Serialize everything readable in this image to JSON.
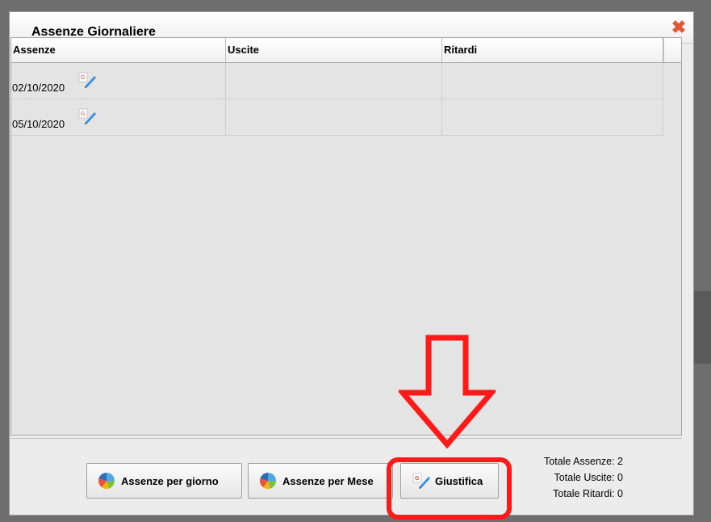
{
  "dialog": {
    "title": "Assenze Giornaliere",
    "close_icon": "close-x-icon",
    "close_color": "#e05a3a"
  },
  "table": {
    "columns": [
      "Assenze",
      "Uscite",
      "Ritardi"
    ],
    "rows": [
      {
        "assenze": "02/10/2020",
        "uscite": "",
        "ritardi": "",
        "icon": "justify-edit-icon"
      },
      {
        "assenze": "05/10/2020",
        "uscite": "",
        "ritardi": "",
        "icon": "justify-edit-icon"
      }
    ]
  },
  "buttons": {
    "per_giorno": {
      "label": "Assenze per giorno",
      "icon": "pie-chart-icon"
    },
    "per_mese": {
      "label": "Assenze per Mese",
      "icon": "pie-chart-icon"
    },
    "giustifica": {
      "label": "Giustifica",
      "icon": "justify-edit-icon"
    }
  },
  "totals": {
    "assenze": "Totale Assenze: 2",
    "uscite": "Totale Uscite: 0",
    "ritardi": "Totale Ritardi: 0"
  },
  "annotation": {
    "color": "#ff1a1a",
    "shapes": [
      "down-arrow",
      "highlight-box"
    ]
  }
}
